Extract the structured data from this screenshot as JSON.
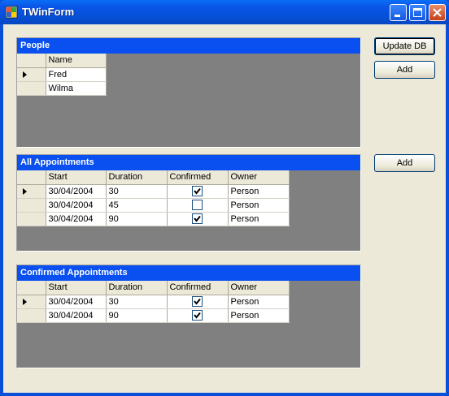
{
  "window": {
    "title": "TWinForm"
  },
  "buttons": {
    "update_db": "Update DB",
    "add_person": "Add",
    "add_appointment": "Add"
  },
  "people": {
    "caption": "People",
    "columns": [
      "Name"
    ],
    "rows": [
      {
        "name": "Fred",
        "current": true
      },
      {
        "name": "Wilma",
        "current": false
      }
    ]
  },
  "all_appointments": {
    "caption": "All Appointments",
    "columns": [
      "Start",
      "Duration",
      "Confirmed",
      "Owner"
    ],
    "rows": [
      {
        "start": "30/04/2004",
        "duration": "30",
        "confirmed": true,
        "owner": "Person",
        "current": true
      },
      {
        "start": "30/04/2004",
        "duration": "45",
        "confirmed": false,
        "owner": "Person",
        "current": false
      },
      {
        "start": "30/04/2004",
        "duration": "90",
        "confirmed": true,
        "owner": "Person",
        "current": false
      }
    ]
  },
  "confirmed_appointments": {
    "caption": "Confirmed Appointments",
    "columns": [
      "Start",
      "Duration",
      "Confirmed",
      "Owner"
    ],
    "rows": [
      {
        "start": "30/04/2004",
        "duration": "30",
        "confirmed": true,
        "owner": "Person",
        "current": true
      },
      {
        "start": "30/04/2004",
        "duration": "90",
        "confirmed": true,
        "owner": "Person",
        "current": false
      }
    ]
  }
}
